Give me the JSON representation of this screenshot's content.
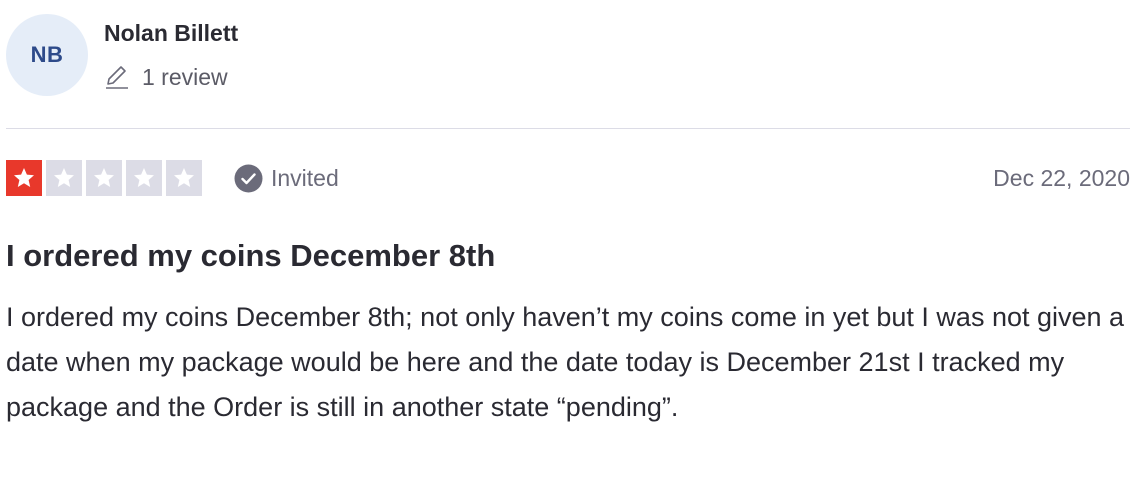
{
  "consumer": {
    "initials": "NB",
    "name": "Nolan Billett",
    "review_count": "1 review",
    "icon": "pencil-icon",
    "avatar_bg": "#e5edf8",
    "avatar_fg": "#2d4a8a"
  },
  "rating": {
    "stars": 1,
    "max_stars": 5,
    "filled_color": "#e8382b",
    "empty_color": "#dcdce6"
  },
  "verification": {
    "label": "Invited",
    "icon": "check-circle-icon"
  },
  "review": {
    "date": "Dec 22, 2020",
    "title": "I ordered my coins December 8th",
    "body": "I ordered my coins December 8th; not only haven’t my coins come in yet but I was not given a date when my package would be here and the date today is December 21st I tracked my package and the Order is still in another state “pending”."
  }
}
